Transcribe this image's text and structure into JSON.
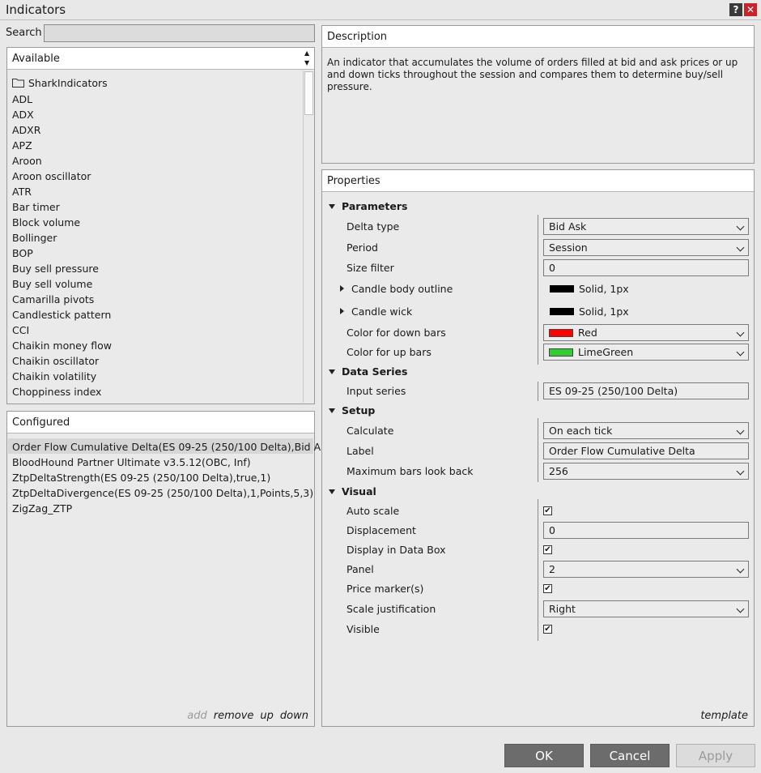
{
  "window": {
    "title": "Indicators",
    "help_glyph": "?",
    "close_glyph": "✕"
  },
  "search": {
    "label": "Search",
    "value": ""
  },
  "available": {
    "header": "Available",
    "folder": "SharkIndicators",
    "items": [
      "ADL",
      "ADX",
      "ADXR",
      "APZ",
      "Aroon",
      "Aroon oscillator",
      "ATR",
      "Bar timer",
      "Block volume",
      "Bollinger",
      "BOP",
      "Buy sell pressure",
      "Buy sell volume",
      "Camarilla pivots",
      "Candlestick pattern",
      "CCI",
      "Chaikin money flow",
      "Chaikin oscillator",
      "Chaikin volatility",
      "Choppiness index"
    ]
  },
  "configured": {
    "header": "Configured",
    "items": [
      "Order Flow Cumulative Delta(ES 09-25 (250/100 Delta),Bid A...",
      "BloodHound Partner Ultimate v3.5.12(OBC, Inf)",
      "ZtpDeltaStrength(ES 09-25 (250/100 Delta),true,1)",
      "ZtpDeltaDivergence(ES 09-25 (250/100 Delta),1,Points,5,3)",
      "ZigZag_ZTP"
    ],
    "actions": {
      "add": "add",
      "remove": "remove",
      "up": "up",
      "down": "down"
    }
  },
  "description": {
    "header": "Description",
    "text": "An indicator that accumulates the volume of orders filled at bid and ask prices or up and down ticks throughout the session and compares them to determine buy/sell pressure."
  },
  "properties": {
    "header": "Properties",
    "groups": {
      "parameters": "Parameters",
      "data_series": "Data Series",
      "setup": "Setup",
      "visual": "Visual"
    },
    "labels": {
      "delta_type": "Delta type",
      "period": "Period",
      "size_filter": "Size filter",
      "candle_body_outline": "Candle body outline",
      "candle_wick": "Candle wick",
      "color_down": "Color for down bars",
      "color_up": "Color for up bars",
      "input_series": "Input series",
      "calculate": "Calculate",
      "label": "Label",
      "max_bars": "Maximum bars look back",
      "auto_scale": "Auto scale",
      "displacement": "Displacement",
      "display_data_box": "Display in Data Box",
      "panel": "Panel",
      "price_markers": "Price marker(s)",
      "scale_justification": "Scale justification",
      "visible": "Visible"
    },
    "values": {
      "delta_type": "Bid Ask",
      "period": "Session",
      "size_filter": "0",
      "candle_body_outline": "Solid, 1px",
      "candle_wick": "Solid, 1px",
      "color_down": "Red",
      "color_up": "LimeGreen",
      "input_series": "ES 09-25 (250/100 Delta)",
      "calculate": "On each tick",
      "label": "Order Flow Cumulative Delta",
      "max_bars": "256",
      "displacement": "0",
      "panel": "2",
      "scale_justification": "Right",
      "check_mark": "✔"
    },
    "colors": {
      "down": "#ff0000",
      "up": "#32cd32"
    },
    "template_link": "template"
  },
  "buttons": {
    "ok": "OK",
    "cancel": "Cancel",
    "apply": "Apply"
  }
}
